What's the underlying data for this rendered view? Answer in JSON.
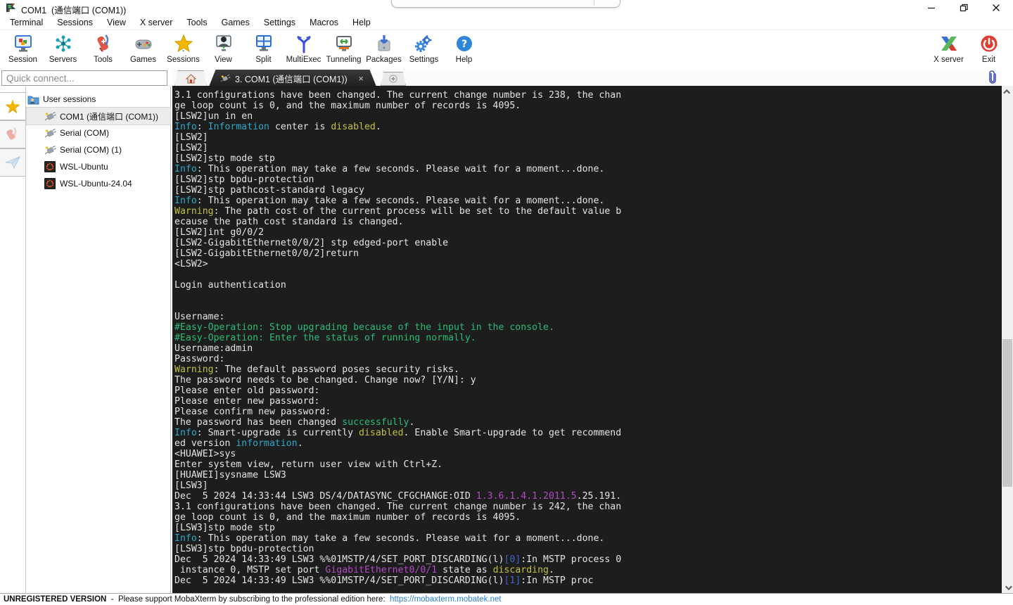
{
  "window": {
    "title": "COM1  (通信端口 (COM1))",
    "controls": {
      "minimize": "minimize",
      "restore": "restore",
      "close": "close"
    }
  },
  "menu": [
    "Terminal",
    "Sessions",
    "View",
    "X server",
    "Tools",
    "Games",
    "Settings",
    "Macros",
    "Help"
  ],
  "toolbar": {
    "left": [
      {
        "icon": "session-icon",
        "label": "Session"
      },
      {
        "icon": "servers-icon",
        "label": "Servers"
      },
      {
        "icon": "tools-icon",
        "label": "Tools"
      },
      {
        "icon": "games-icon",
        "label": "Games"
      },
      {
        "icon": "sessions-star-icon",
        "label": "Sessions"
      },
      {
        "icon": "view-icon",
        "label": "View"
      },
      {
        "icon": "split-icon",
        "label": "Split"
      },
      {
        "icon": "multiexec-icon",
        "label": "MultiExec"
      },
      {
        "icon": "tunneling-icon",
        "label": "Tunneling"
      },
      {
        "icon": "packages-icon",
        "label": "Packages"
      },
      {
        "icon": "settings-icon",
        "label": "Settings"
      },
      {
        "icon": "help-icon",
        "label": "Help"
      }
    ],
    "right": [
      {
        "icon": "xserver-icon",
        "label": "X server"
      },
      {
        "icon": "exit-icon",
        "label": "Exit"
      }
    ]
  },
  "quick_connect": {
    "placeholder": "Quick connect..."
  },
  "tabbar": {
    "active_tab": {
      "label": "3. COM1  (通信端口 (COM1))",
      "close": "×"
    },
    "new_tab": "+"
  },
  "sidebar": {
    "tabs": [
      {
        "icon": "favorites-star-icon",
        "active": true
      },
      {
        "icon": "macros-knife-icon",
        "active": false
      },
      {
        "icon": "send-plane-icon",
        "active": false
      }
    ],
    "tree": [
      {
        "label": "User sessions",
        "icon": "user-sessions-folder-icon",
        "level": 0,
        "selected": false
      },
      {
        "label": "COM1  (通信端口 (COM1))",
        "icon": "serial-plug-icon",
        "level": 1,
        "selected": true
      },
      {
        "label": "Serial (COM)",
        "icon": "serial-plug-icon",
        "level": 1,
        "selected": false
      },
      {
        "label": "Serial (COM) (1)",
        "icon": "serial-plug-icon",
        "level": 1,
        "selected": false
      },
      {
        "label": "WSL-Ubuntu",
        "icon": "ubuntu-icon",
        "level": 1,
        "selected": false
      },
      {
        "label": "WSL-Ubuntu-24.04",
        "icon": "ubuntu-icon",
        "level": 1,
        "selected": false
      }
    ]
  },
  "terminal": {
    "palette": {
      "w": "#e4e4e4",
      "c": "#2da9c9",
      "y": "#c0c23f",
      "g": "#28bd78",
      "m": "#b14bc4",
      "b": "#3f66cc",
      "bg": "#1d1d1d"
    },
    "lines": [
      "3.1 configurations have been changed. The current change number is 238, the chan",
      "ge loop count is 0, and the maximum number of records is 4095.",
      "[LSW2]un in en",
      [
        [
          "Info",
          "c"
        ],
        [
          ": ",
          "w"
        ],
        [
          "Information",
          "c"
        ],
        [
          " center is ",
          "w"
        ],
        [
          "disabled",
          "y"
        ],
        [
          ".",
          "w"
        ]
      ],
      "[LSW2]",
      "[LSW2]",
      "[LSW2]stp mode stp",
      [
        [
          "Info",
          "c"
        ],
        [
          ": This operation may take a few seconds. Please wait for a moment...done.",
          "w"
        ]
      ],
      "[LSW2]stp bpdu-protection",
      "[LSW2]stp pathcost-standard legacy",
      [
        [
          "Info",
          "c"
        ],
        [
          ": This operation may take a few seconds. Please wait for a moment...done.",
          "w"
        ]
      ],
      [
        [
          "Warning",
          "y"
        ],
        [
          ": The path cost of the current process will be set to the default value b",
          "w"
        ]
      ],
      "ecause the path cost standard is changed.",
      "[LSW2]int g0/0/2",
      "[LSW2-GigabitEthernet0/0/2] stp edged-port enable",
      "[LSW2-GigabitEthernet0/0/2]return",
      "<LSW2>",
      "",
      "Login authentication",
      "",
      "",
      "Username:",
      [
        [
          "#Easy-Operation: Stop upgrading because of the input in the console.",
          "g"
        ]
      ],
      [
        [
          "#Easy-Operation: Enter the status of running normally.",
          "g"
        ]
      ],
      "Username:admin",
      "Password:",
      [
        [
          "Warning",
          "y"
        ],
        [
          ": The default password poses security risks.",
          "w"
        ]
      ],
      "The password needs to be changed. Change now? [Y/N]: y",
      "Please enter old password:",
      "Please enter new password:",
      "Please confirm new password:",
      [
        [
          "The password has been changed ",
          "w"
        ],
        [
          "successfully",
          "g"
        ],
        [
          ".",
          "w"
        ]
      ],
      [
        [
          "Info",
          "c"
        ],
        [
          ": Smart-upgrade is currently ",
          "w"
        ],
        [
          "disabled",
          "y"
        ],
        [
          ". Enable Smart-upgrade to get recommend",
          "w"
        ]
      ],
      [
        [
          "ed version ",
          "w"
        ],
        [
          "information",
          "c"
        ],
        [
          ".",
          "w"
        ]
      ],
      "<HUAWEI>sys",
      "Enter system view, return user view with Ctrl+Z.",
      "[HUAWEI]sysname LSW3",
      "[LSW3]",
      [
        [
          "Dec  5 2024 14:33:44 LSW3 DS/4/DATASYNC_CFGCHANGE:OID ",
          "w"
        ],
        [
          "1.3.6.1.4.1.2011.5",
          "m"
        ],
        [
          ".25.191.",
          "w"
        ]
      ],
      "3.1 configurations have been changed. The current change number is 242, the chan",
      "ge loop count is 0, and the maximum number of records is 4095.",
      "[LSW3]stp mode stp",
      [
        [
          "Info",
          "c"
        ],
        [
          ": This operation may take a few seconds. Please wait for a moment...done.",
          "w"
        ]
      ],
      "[LSW3]stp bpdu-protection",
      [
        [
          "Dec  5 2024 14:33:49 LSW3 %%01MSTP/4/SET_PORT_DISCARDING(l)",
          "w"
        ],
        [
          "[0]",
          "b"
        ],
        [
          ":In MSTP process 0",
          "w"
        ]
      ],
      [
        [
          " instance 0, MSTP set port ",
          "w"
        ],
        [
          "GigabitEthernet0/0/1",
          "m"
        ],
        [
          " state as ",
          "w"
        ],
        [
          "discarding",
          "y"
        ],
        [
          ".",
          "w"
        ]
      ],
      [
        [
          "Dec  5 2024 14:33:49 LSW3 %%01MSTP/4/SET_PORT_DISCARDING(l)",
          "w"
        ],
        [
          "[1]",
          "b"
        ],
        [
          ":In MSTP proc",
          "w"
        ]
      ]
    ]
  },
  "statusbar": {
    "registration": "UNREGISTERED VERSION",
    "message": "  -  Please support MobaXterm by subscribing to the professional edition here:  ",
    "link": "https://mobaxterm.mobatek.net"
  },
  "colors": {
    "terminal_bg": "#1d1d1d",
    "accent_link": "#2a7fd4",
    "tab_active_bg": "#2a2a2a",
    "selection_bg": "#ececec"
  }
}
